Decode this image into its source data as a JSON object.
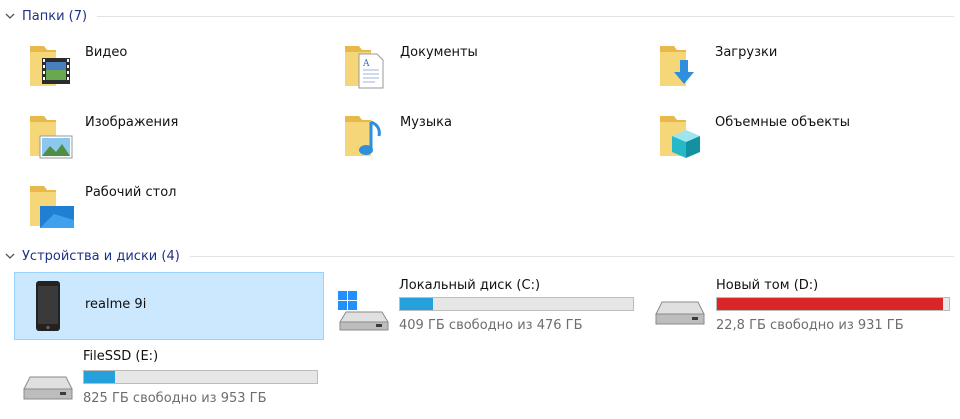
{
  "groups": {
    "folders": {
      "title": "Папки (7)"
    },
    "devices": {
      "title": "Устройства и диски (4)"
    }
  },
  "folders": [
    {
      "label": "Видео",
      "icon": "video-folder-icon"
    },
    {
      "label": "Документы",
      "icon": "documents-folder-icon"
    },
    {
      "label": "Загрузки",
      "icon": "downloads-folder-icon"
    },
    {
      "label": "Изображения",
      "icon": "pictures-folder-icon"
    },
    {
      "label": "Музыка",
      "icon": "music-folder-icon"
    },
    {
      "label": "Объемные объекты",
      "icon": "3d-objects-folder-icon"
    },
    {
      "label": "Рабочий стол",
      "icon": "desktop-folder-icon"
    }
  ],
  "devices": [
    {
      "label": "realme 9i",
      "icon": "phone-icon",
      "selected": true
    },
    {
      "label": "Локальный диск (C:)",
      "free": "409 ГБ свободно из 476 ГБ",
      "used_fraction": 0.141,
      "bar_color": "#26a0da",
      "icon": "system-drive-icon"
    },
    {
      "label": "Новый том (D:)",
      "free": "22,8 ГБ свободно из 931 ГБ",
      "used_fraction": 0.975,
      "bar_color": "#da2626",
      "icon": "hard-drive-icon"
    },
    {
      "label": "FileSSD (E:)",
      "free": "825 ГБ свободно из 953 ГБ",
      "used_fraction": 0.134,
      "bar_color": "#26a0da",
      "icon": "hard-drive-icon"
    }
  ],
  "colors": {
    "accent": "#26a0da",
    "warning": "#da2626",
    "selection_bg": "#cce8ff",
    "group_title": "#1e3287"
  }
}
